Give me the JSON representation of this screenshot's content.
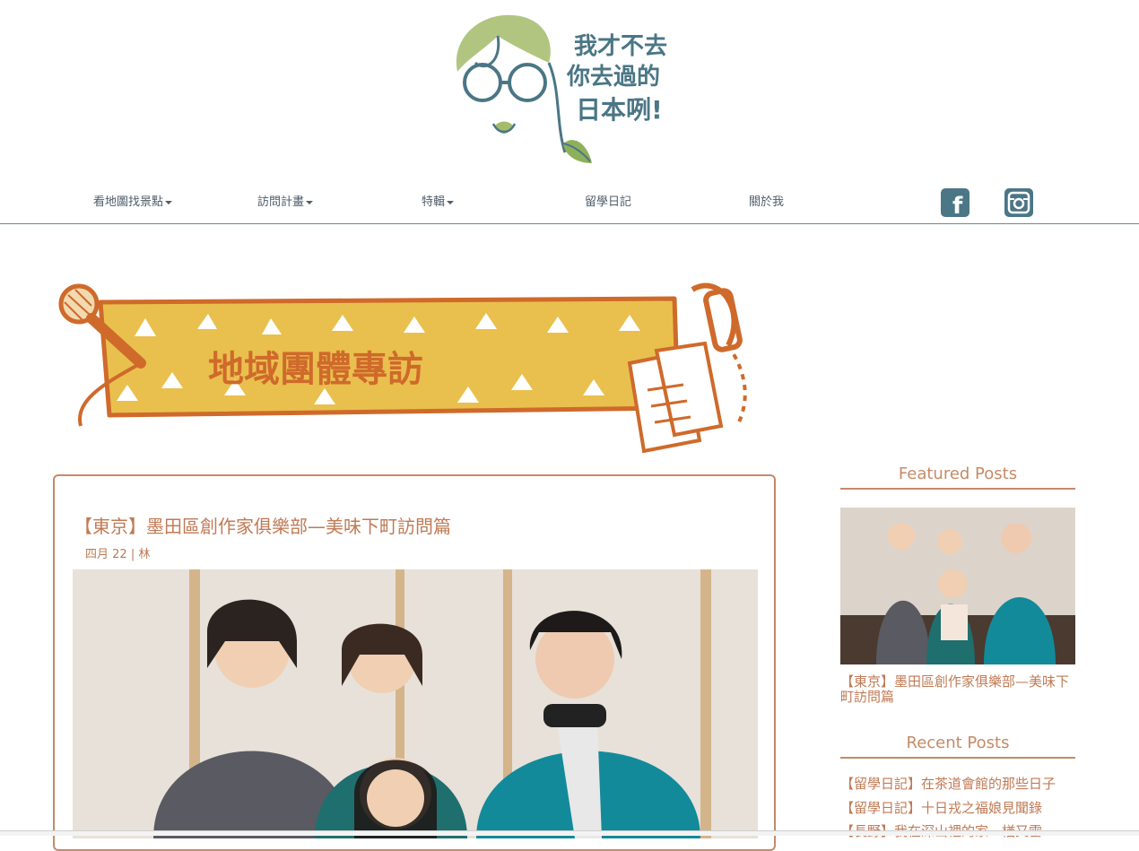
{
  "logo": {
    "lines": [
      "我才不去",
      "你去過的",
      "日本咧!"
    ]
  },
  "nav": {
    "items": [
      {
        "label": "看地圖找景點",
        "dropdown": true
      },
      {
        "label": "訪問計畫",
        "dropdown": true
      },
      {
        "label": "特輯",
        "dropdown": true
      },
      {
        "label": "留學日記",
        "dropdown": false
      },
      {
        "label": "關於我",
        "dropdown": false
      }
    ],
    "social": [
      {
        "icon": "facebook-icon",
        "glyph": "f"
      },
      {
        "icon": "instagram-icon"
      }
    ]
  },
  "banner": {
    "title": "地域團體專訪"
  },
  "post": {
    "title": "【東京】墨田區創作家俱樂部—美味下町訪問篇",
    "date": "四月 22",
    "separator": "|",
    "author": "林"
  },
  "sidebar": {
    "featured_heading": "Featured Posts",
    "featured": [
      {
        "title": "【東京】墨田區創作家俱樂部—美味下町訪問篇"
      }
    ],
    "recent_heading": "Recent Posts",
    "recent": [
      {
        "title": "【留學日記】在茶道會館的那些日子"
      },
      {
        "title": "【留學日記】十日戎之福娘見聞錄"
      },
      {
        "title": "【長野】我在深山裡的家—楢又雲"
      }
    ]
  },
  "colors": {
    "accent": "#c58a68",
    "nav_text": "#4e5d6a",
    "logo_teal": "#4a7685",
    "logo_green": "#8fb05a",
    "banner_yellow": "#e9c04e",
    "banner_orange": "#cf6a2b"
  }
}
